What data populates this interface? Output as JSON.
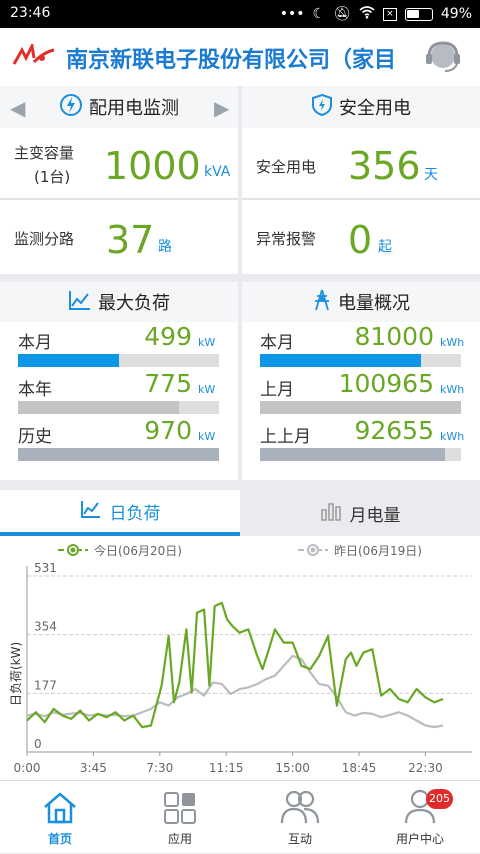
{
  "status": {
    "time": "23:46",
    "battery": "49%"
  },
  "header": {
    "title": "南京新联电子股份有限公司（家目"
  },
  "section_monitor": {
    "title": "配用电监测",
    "capacity_label": "主变容量",
    "capacity_sub": "(1台)",
    "capacity_value": "1000",
    "capacity_unit": "kVA",
    "branches_label": "监测分路",
    "branches_value": "37",
    "branches_unit": "路"
  },
  "section_safety": {
    "title": "安全用电",
    "safe_label": "安全用电",
    "safe_value": "356",
    "safe_unit": "天",
    "alarm_label": "异常报警",
    "alarm_value": "0",
    "alarm_unit": "起"
  },
  "section_maxload": {
    "title": "最大负荷",
    "rows": [
      {
        "label": "本月",
        "value": "499",
        "unit": "kW",
        "fraction": 0.5,
        "color": "#0b97e6"
      },
      {
        "label": "本年",
        "value": "775",
        "unit": "kW",
        "fraction": 0.8,
        "color": "#c4c4c4"
      },
      {
        "label": "历史",
        "value": "970",
        "unit": "kW",
        "fraction": 1.0,
        "color": "#a9b1bc"
      }
    ]
  },
  "section_energy": {
    "title": "电量概况",
    "rows": [
      {
        "label": "本月",
        "value": "81000",
        "unit": "kWh",
        "fraction": 0.8,
        "color": "#0b97e6"
      },
      {
        "label": "上月",
        "value": "100965",
        "unit": "kWh",
        "fraction": 1.0,
        "color": "#c4c4c4"
      },
      {
        "label": "上上月",
        "value": "92655",
        "unit": "kWh",
        "fraction": 0.92,
        "color": "#a9b1bc"
      }
    ]
  },
  "tabs": {
    "daily": "日负荷",
    "monthly": "月电量"
  },
  "chart_data": {
    "type": "line",
    "ylabel": "日负荷(kW)",
    "ylim": [
      0,
      531
    ],
    "yticks": [
      "531",
      "354",
      "177",
      "0"
    ],
    "xticks": [
      "0:00",
      "3:45",
      "7:30",
      "11:15",
      "15:00",
      "18:45",
      "22:30"
    ],
    "xlim_hours": [
      0,
      24
    ],
    "series": [
      {
        "name": "今日(06月20日)",
        "color": "#6aa725",
        "x": [
          0,
          0.5,
          1,
          1.5,
          2,
          2.5,
          3,
          3.5,
          4,
          4.5,
          5,
          5.5,
          6,
          6.5,
          7,
          7.3,
          7.6,
          8,
          8.3,
          8.6,
          9,
          9.3,
          9.6,
          10,
          10.3,
          10.6,
          11,
          11.3,
          11.6,
          12,
          12.5,
          13,
          13.3,
          13.6,
          14,
          14.5,
          15,
          15.5,
          16,
          16.5,
          17,
          17.5,
          18,
          18.3,
          18.6,
          19,
          19.5,
          20,
          20.5,
          21,
          21.5,
          22,
          22.5,
          23,
          23.5
        ],
        "y": [
          95,
          120,
          90,
          130,
          110,
          100,
          125,
          95,
          115,
          105,
          120,
          95,
          110,
          75,
          80,
          140,
          200,
          350,
          150,
          210,
          370,
          180,
          420,
          430,
          200,
          440,
          450,
          400,
          380,
          360,
          370,
          290,
          250,
          300,
          370,
          330,
          330,
          260,
          250,
          290,
          350,
          140,
          280,
          300,
          260,
          300,
          310,
          170,
          190,
          160,
          150,
          190,
          165,
          150,
          160
        ]
      },
      {
        "name": "昨日(06月19日)",
        "color": "#b9bcc0",
        "x": [
          0,
          0.5,
          1,
          1.5,
          2,
          2.5,
          3,
          3.5,
          4,
          4.5,
          5,
          5.5,
          6,
          6.5,
          7,
          7.5,
          8,
          8.5,
          9,
          9.5,
          10,
          10.5,
          11,
          11.5,
          12,
          12.5,
          13,
          13.5,
          14,
          14.5,
          15,
          15.5,
          16,
          16.5,
          17,
          17.5,
          18,
          18.5,
          19,
          19.5,
          20,
          20.5,
          21,
          21.5,
          22,
          22.5,
          23,
          23.5
        ],
        "y": [
          110,
          115,
          108,
          120,
          112,
          116,
          118,
          110,
          114,
          110,
          112,
          108,
          110,
          120,
          130,
          150,
          140,
          165,
          175,
          190,
          170,
          210,
          205,
          175,
          190,
          195,
          205,
          220,
          230,
          260,
          290,
          280,
          240,
          205,
          200,
          165,
          120,
          110,
          118,
          115,
          105,
          112,
          120,
          110,
          95,
          80,
          75,
          80
        ]
      }
    ]
  },
  "nav": [
    {
      "label": "首页",
      "icon": "home-icon",
      "active": true
    },
    {
      "label": "应用",
      "icon": "apps-grid-icon",
      "active": false
    },
    {
      "label": "互动",
      "icon": "interaction-users-icon",
      "active": false
    },
    {
      "label": "用户中心",
      "icon": "user-center-icon",
      "active": false,
      "badge": "205"
    }
  ]
}
